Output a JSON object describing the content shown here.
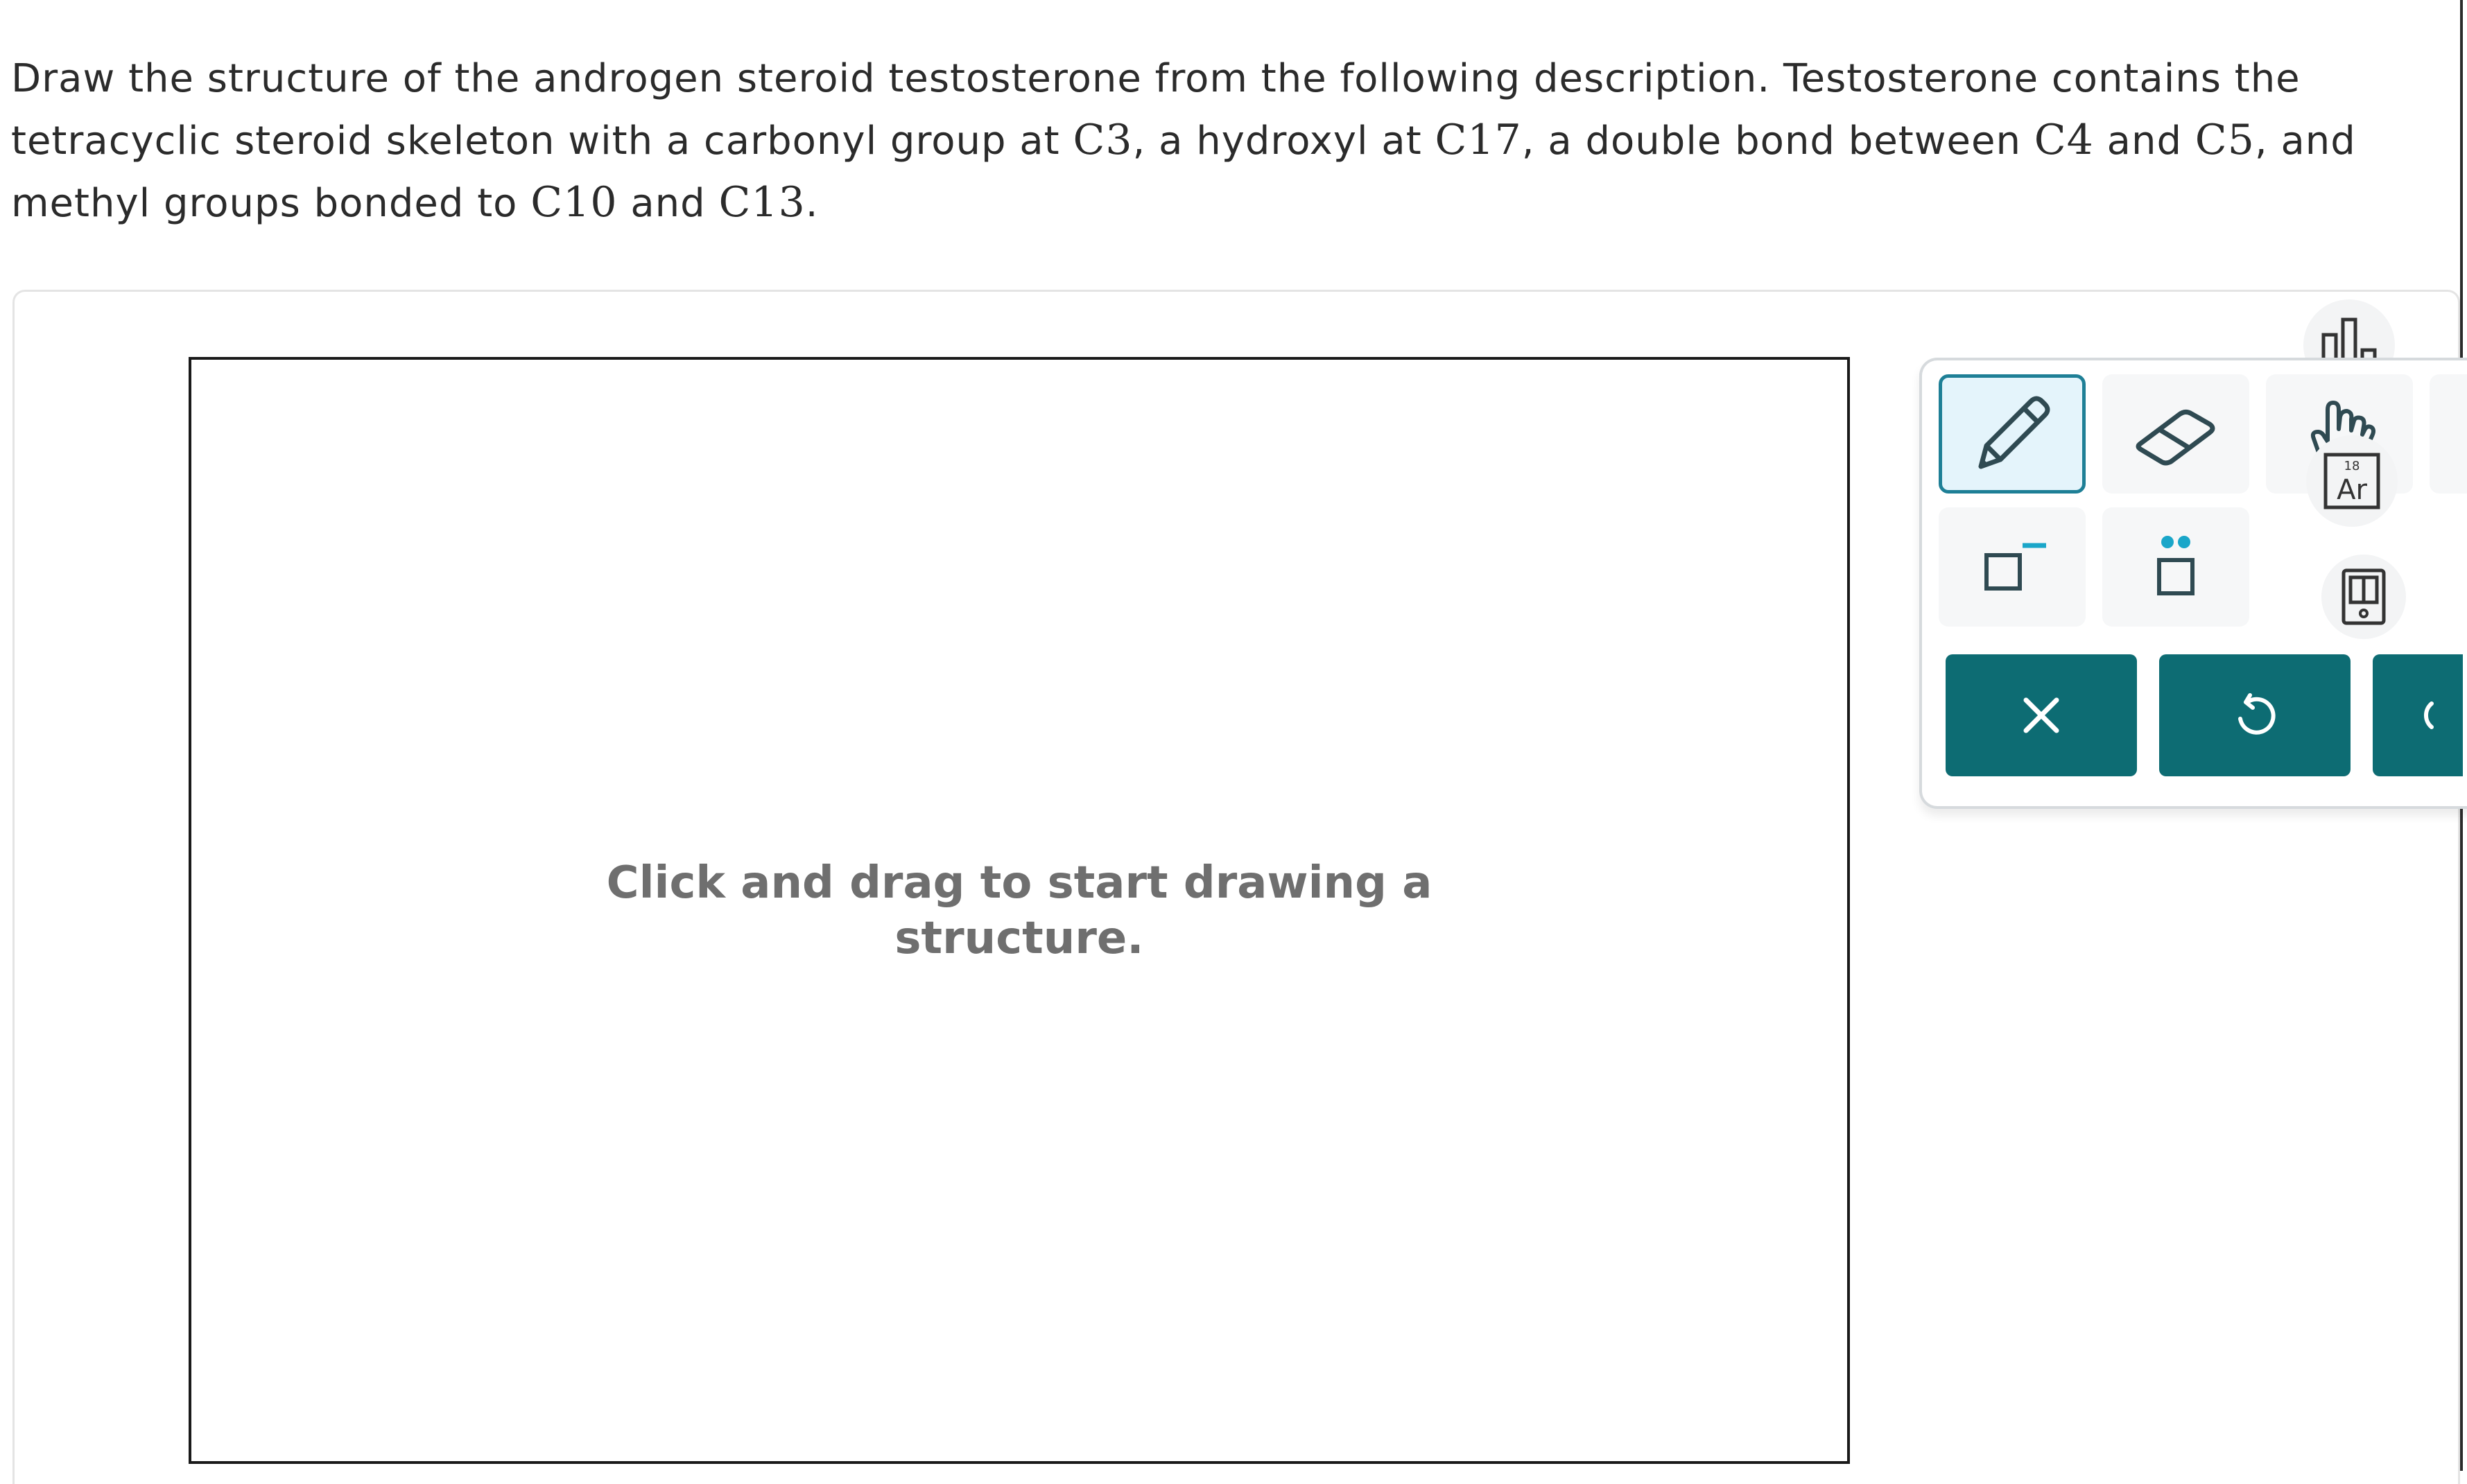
{
  "question": {
    "part1": "Draw the structure of the androgen steroid testosterone from the following description. Testosterone contains the tetracyclic steroid skeleton with a carbonyl group at ",
    "c3": "C3",
    "part2": ", a hydroxyl at ",
    "c17": "C17",
    "part3": ", a double bond between ",
    "c4": "C4",
    "part4": " and ",
    "c5": "C5",
    "part5": ", and methyl groups bonded to ",
    "c10": "C10",
    "part6": " and ",
    "c13": "C13",
    "part7": "."
  },
  "canvas": {
    "hint_line1": "Click and drag to start drawing a",
    "hint_line2": "structure."
  },
  "toolbar": {
    "periodic_badge_number": "18",
    "periodic_badge_symbol": "Ar"
  },
  "colors": {
    "accent": "#0d6c73",
    "active_border": "#1e7f96",
    "active_fill": "#e4f4fb",
    "lone_pair_dots": "#1aa6c9",
    "charge_mark": "#1aa6c9"
  },
  "icons": [
    "pencil-icon",
    "eraser-icon",
    "hand-icon",
    "templates-icon",
    "periodic-table-icon",
    "charge-icon",
    "lone-pair-icon",
    "calculator-icon",
    "close-icon",
    "undo-icon",
    "redo-icon"
  ]
}
